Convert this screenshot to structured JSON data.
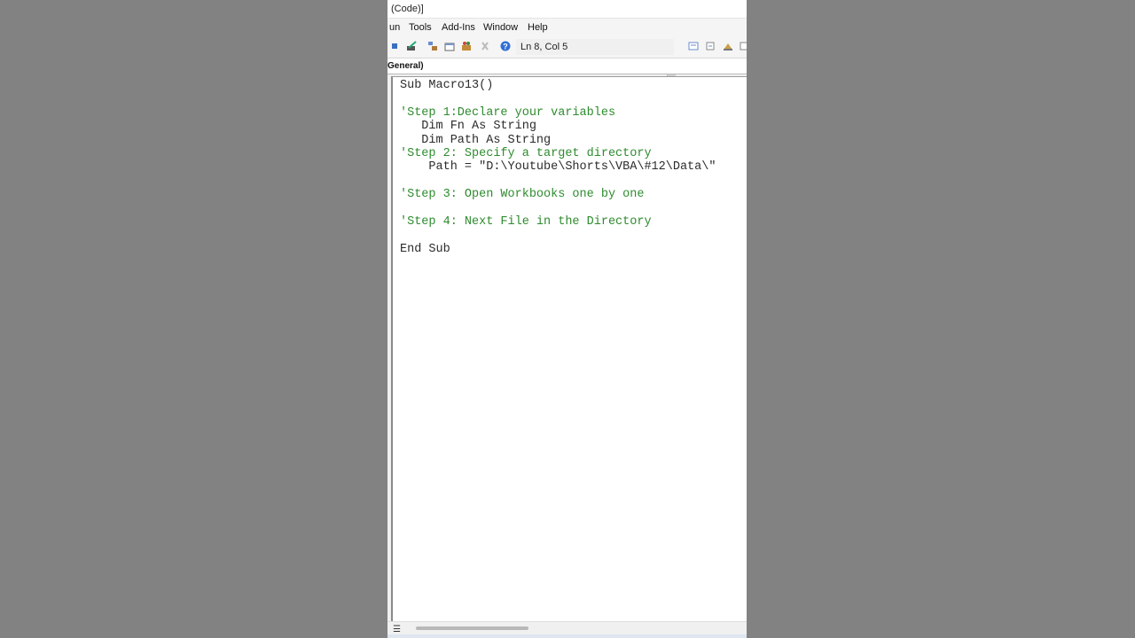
{
  "window": {
    "title": "(Code)]"
  },
  "menu": {
    "items": [
      "un",
      "Tools",
      "Add-Ins",
      "Window",
      "Help"
    ]
  },
  "toolbar": {
    "position": "Ln 8, Col 5"
  },
  "object_combo": {
    "value": "General)"
  },
  "code": {
    "lines": [
      {
        "text": "Sub Macro13()",
        "type": "code"
      },
      {
        "text": "",
        "type": "code"
      },
      {
        "text": "'Step 1:Declare your variables",
        "type": "comment"
      },
      {
        "text": "   Dim Fn As String",
        "type": "code"
      },
      {
        "text": "   Dim Path As String",
        "type": "code"
      },
      {
        "text": "'Step 2: Specify a target directory",
        "type": "comment"
      },
      {
        "text": "    Path = \"D:\\Youtube\\Shorts\\VBA\\#12\\Data\\\"",
        "type": "code"
      },
      {
        "text": "",
        "type": "code"
      },
      {
        "text": "'Step 3: Open Workbooks one by one",
        "type": "comment"
      },
      {
        "text": "",
        "type": "code"
      },
      {
        "text": "'Step 4: Next File in the Directory",
        "type": "comment"
      },
      {
        "text": "",
        "type": "code"
      },
      {
        "text": "End Sub",
        "type": "code"
      }
    ]
  },
  "colors": {
    "comment": "#2e8b2e",
    "code": "#2b2b2b",
    "background": "#828282"
  }
}
